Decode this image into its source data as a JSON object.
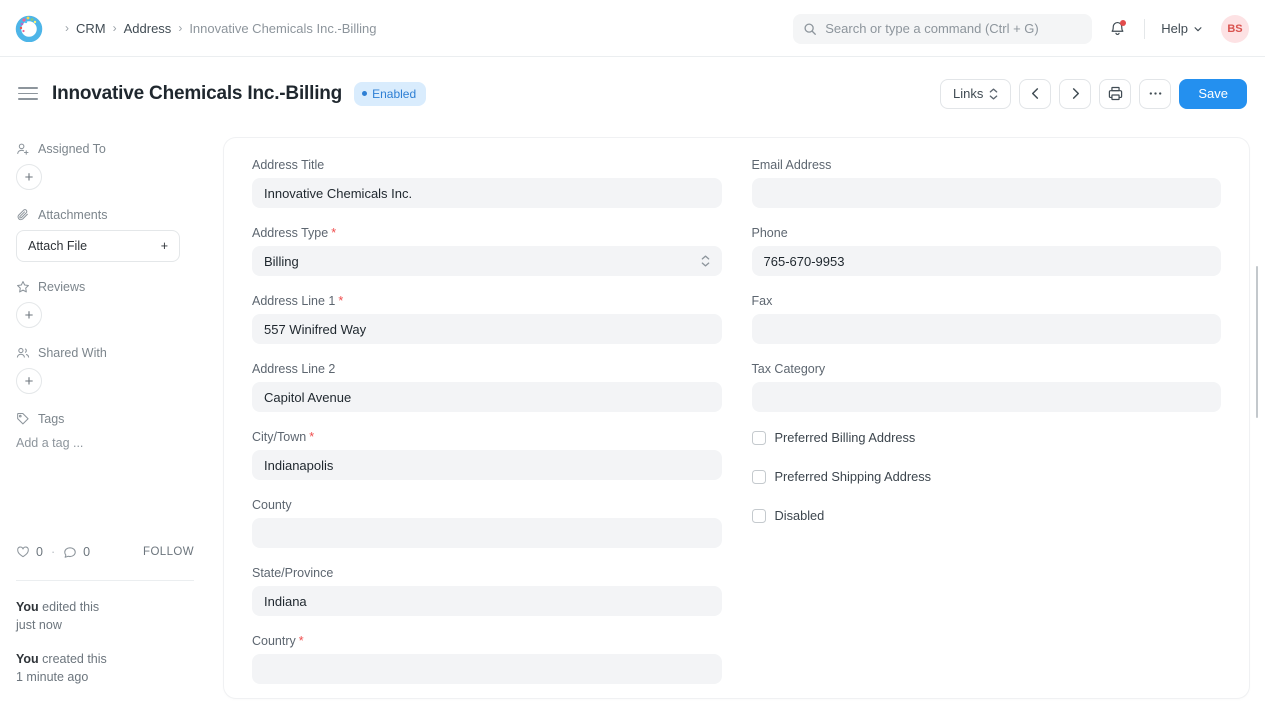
{
  "navbar": {
    "logo_name": "frappe-logo",
    "breadcrumb": [
      {
        "label": "CRM",
        "current": false
      },
      {
        "label": "Address",
        "current": false
      },
      {
        "label": "Innovative Chemicals Inc.-Billing",
        "current": true
      }
    ],
    "search": {
      "placeholder": "Search or type a command (Ctrl + G)",
      "value": "",
      "icon": "search-icon"
    },
    "notifications": {
      "icon": "bell-icon",
      "has_unread": true,
      "unread_color": "#e24c4c"
    },
    "help": {
      "label": "Help",
      "icon": "chevron-down-icon"
    },
    "avatar": {
      "initials": "BS",
      "bg": "#fde2e4",
      "fg": "#d9534f"
    }
  },
  "header": {
    "menu_icon": "hamburger-icon",
    "title": "Innovative Chemicals Inc.-Billing",
    "status_badge": {
      "label": "Enabled",
      "color": "#2e7fd4",
      "bg": "#d9ecfd"
    },
    "actions": {
      "links_label": "Links",
      "prev_icon": "chevron-left-icon",
      "next_icon": "chevron-right-icon",
      "print_icon": "printer-icon",
      "more_icon": "ellipsis-icon",
      "save_label": "Save",
      "save_color": "#2490ef"
    }
  },
  "sidebar": {
    "assigned_to": {
      "label": "Assigned To",
      "icon": "user-plus-icon",
      "add_label": "+"
    },
    "attachments": {
      "label": "Attachments",
      "icon": "paperclip-icon",
      "attach_label": "Attach File",
      "add_label": "+"
    },
    "reviews": {
      "label": "Reviews",
      "icon": "star-icon",
      "add_label": "+"
    },
    "shared_with": {
      "label": "Shared With",
      "icon": "users-icon",
      "add_label": "+"
    },
    "tags": {
      "label": "Tags",
      "icon": "tag-icon",
      "placeholder": "Add a tag ..."
    },
    "stats": {
      "like_icon": "heart-icon",
      "like_count": "0",
      "separator": "·",
      "comment_icon": "comment-icon",
      "comment_count": "0",
      "follow_label": "FOLLOW"
    },
    "timeline": [
      {
        "actor": "You",
        "action": " edited this",
        "time": "just now"
      },
      {
        "actor": "You",
        "action": " created this",
        "time": "1 minute ago"
      }
    ]
  },
  "form": {
    "left_column": [
      {
        "label": "Address Title",
        "required": false,
        "value": "Innovative Chemicals Inc.",
        "type": "text"
      },
      {
        "label": "Address Type",
        "required": true,
        "value": "Billing",
        "type": "select",
        "icon": "chevron-updown-icon"
      },
      {
        "label": "Address Line 1",
        "required": true,
        "value": "557  Winifred Way",
        "type": "text"
      },
      {
        "label": "Address Line 2",
        "required": false,
        "value": "Capitol Avenue",
        "type": "text"
      },
      {
        "label": "City/Town",
        "required": true,
        "value": "Indianapolis",
        "type": "text"
      },
      {
        "label": "County",
        "required": false,
        "value": "",
        "type": "text"
      },
      {
        "label": "State/Province",
        "required": false,
        "value": "Indiana",
        "type": "text"
      },
      {
        "label": "Country",
        "required": true,
        "value": "",
        "type": "text"
      }
    ],
    "right_column": [
      {
        "label": "Email Address",
        "required": false,
        "value": "",
        "type": "text"
      },
      {
        "label": "Phone",
        "required": false,
        "value": "765-670-9953",
        "type": "text"
      },
      {
        "label": "Fax",
        "required": false,
        "value": "",
        "type": "text"
      },
      {
        "label": "Tax Category",
        "required": false,
        "value": "",
        "type": "text"
      }
    ],
    "checkboxes": [
      {
        "label": "Preferred Billing Address",
        "checked": false
      },
      {
        "label": "Preferred Shipping Address",
        "checked": false
      },
      {
        "label": "Disabled",
        "checked": false
      }
    ]
  }
}
